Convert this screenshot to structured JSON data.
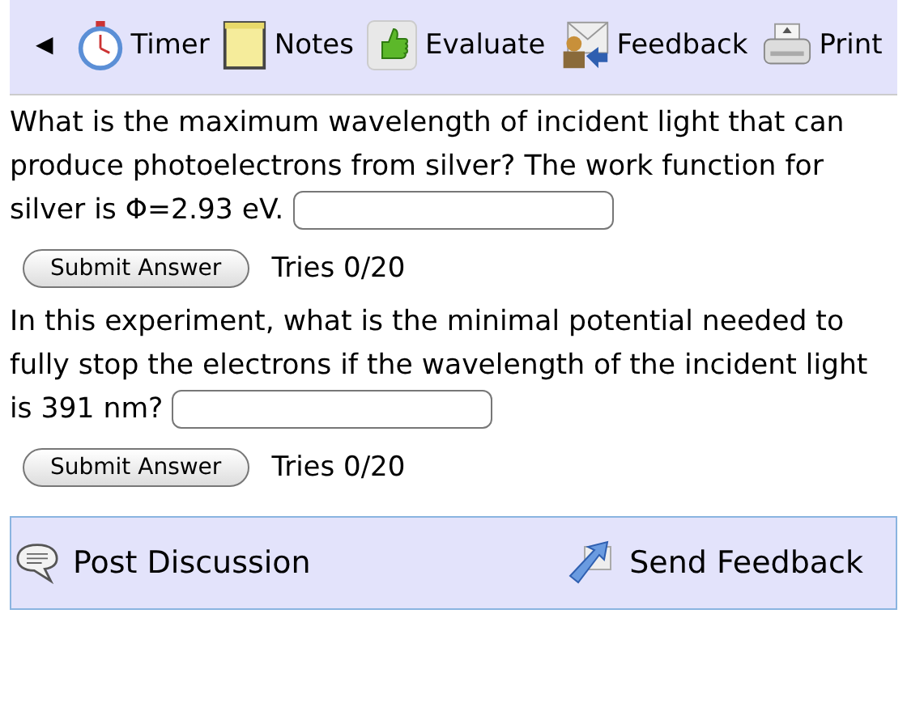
{
  "toolbar": {
    "back": "◀",
    "items": [
      {
        "kind": "timer",
        "label": "Timer"
      },
      {
        "kind": "notes",
        "label": "Notes"
      },
      {
        "kind": "evaluate",
        "label": "Evaluate"
      },
      {
        "kind": "feedback",
        "label": "Feedback"
      },
      {
        "kind": "print",
        "label": "Print"
      }
    ]
  },
  "questions": [
    {
      "text": "What is the maximum wavelength of incident light that can produce photoelectrons from silver? The work function for silver is Φ=2.93 eV.",
      "button": "Submit Answer",
      "tries": "Tries 0/20"
    },
    {
      "text": "In this experiment, what is the minimal potential needed to fully stop the electrons if the wavelength of the incident light is 391 nm?",
      "button": "Submit Answer",
      "tries": "Tries 0/20"
    }
  ],
  "footer": {
    "discussion": "Post Discussion",
    "feedback": "Send Feedback"
  }
}
